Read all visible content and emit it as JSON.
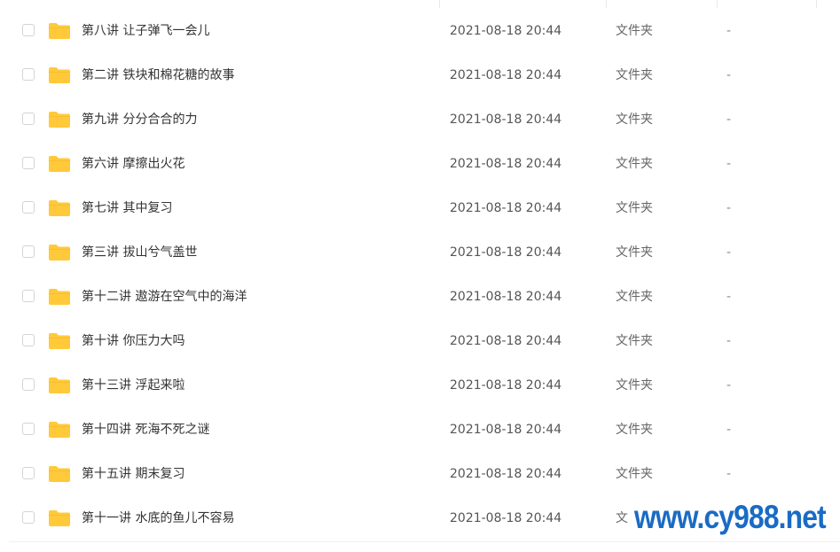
{
  "file_list": {
    "rows": [
      {
        "name": "第八讲 让子弹飞一会儿",
        "modified": "2021-08-18 20:44",
        "type": "文件夹",
        "size": "-"
      },
      {
        "name": "第二讲 铁块和棉花糖的故事",
        "modified": "2021-08-18 20:44",
        "type": "文件夹",
        "size": "-"
      },
      {
        "name": "第九讲 分分合合的力",
        "modified": "2021-08-18 20:44",
        "type": "文件夹",
        "size": "-"
      },
      {
        "name": "第六讲 摩擦出火花",
        "modified": "2021-08-18 20:44",
        "type": "文件夹",
        "size": "-"
      },
      {
        "name": "第七讲 其中复习",
        "modified": "2021-08-18 20:44",
        "type": "文件夹",
        "size": "-"
      },
      {
        "name": "第三讲 拔山兮气盖世",
        "modified": "2021-08-18 20:44",
        "type": "文件夹",
        "size": "-"
      },
      {
        "name": "第十二讲 遨游在空气中的海洋",
        "modified": "2021-08-18 20:44",
        "type": "文件夹",
        "size": "-"
      },
      {
        "name": "第十讲 你压力大吗",
        "modified": "2021-08-18 20:44",
        "type": "文件夹",
        "size": "-"
      },
      {
        "name": "第十三讲 浮起来啦",
        "modified": "2021-08-18 20:44",
        "type": "文件夹",
        "size": "-"
      },
      {
        "name": "第十四讲 死海不死之谜",
        "modified": "2021-08-18 20:44",
        "type": "文件夹",
        "size": "-"
      },
      {
        "name": "第十五讲 期末复习",
        "modified": "2021-08-18 20:44",
        "type": "文件夹",
        "size": "-"
      },
      {
        "name": "第十一讲 水底的鱼儿不容易",
        "modified": "2021-08-18 20:44",
        "type": "文件夹",
        "size": "-"
      }
    ]
  },
  "icons": {
    "folder": "folder-icon",
    "checkbox": "checkbox"
  },
  "colors": {
    "folder": "#ffc93a",
    "watermark": "#1a6bc4"
  },
  "watermark": {
    "text": "www.cy988.net"
  }
}
